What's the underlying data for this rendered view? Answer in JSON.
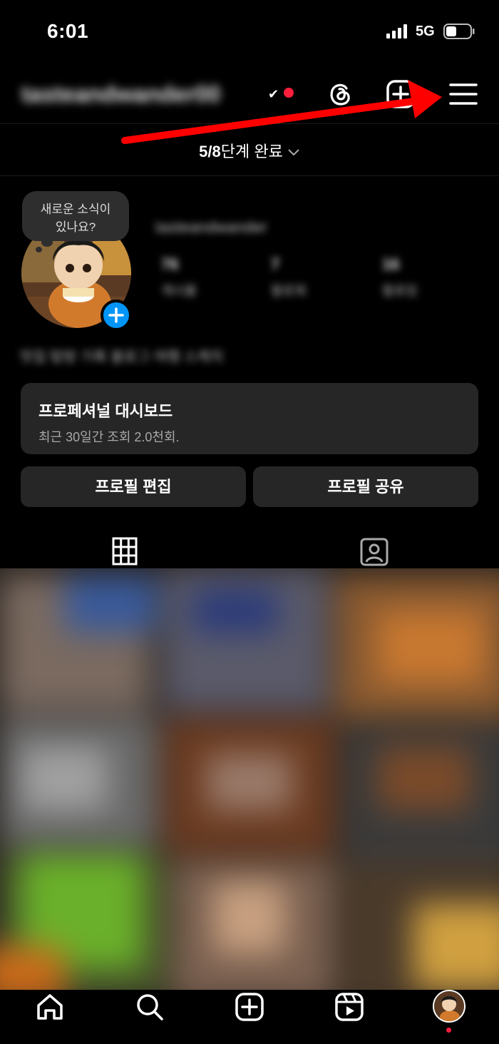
{
  "status_bar": {
    "time": "6:01",
    "network": "5G"
  },
  "header": {
    "username": "tasteandwander00"
  },
  "progress": {
    "count": "5/8",
    "text": "단계 완료"
  },
  "profile": {
    "bubble_line1": "새로운 소식이",
    "bubble_line2": "있나요?",
    "display_name": "tasteandwander",
    "stats": [
      {
        "num": "76",
        "label": "게시물"
      },
      {
        "num": "7",
        "label": "팔로워"
      },
      {
        "num": "16",
        "label": "팔로잉"
      }
    ],
    "bio": "맛집 탐방 기록 블로그 여행 스케치"
  },
  "dashboard": {
    "title": "프로페셔널 대시보드",
    "subtitle": "최근 30일간 조회 2.0천회."
  },
  "buttons": {
    "edit": "프로필 편집",
    "share": "프로필 공유"
  },
  "colors": {
    "accent": "#0095f6",
    "notification": "#ff1e3c",
    "arrow": "#ff0000",
    "card": "#262626"
  }
}
